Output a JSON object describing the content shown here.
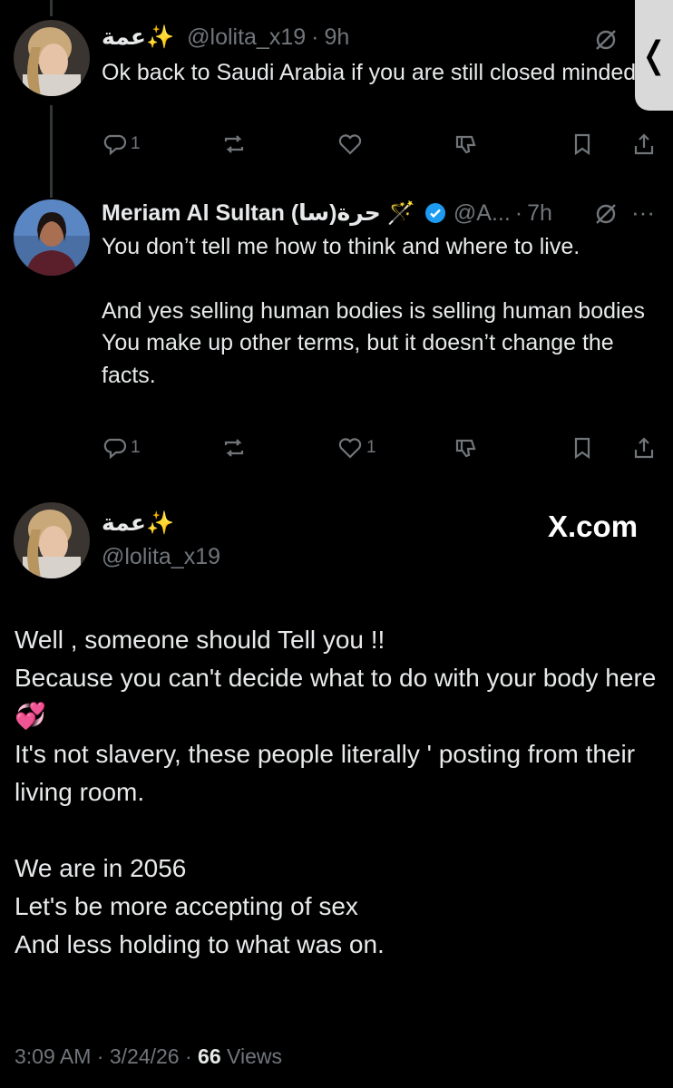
{
  "tweet1": {
    "display_name": "عمة✨",
    "handle": "@lolita_x19",
    "time": "9h",
    "text": "Ok back to Saudi Arabia if you are still closed minded",
    "replies": "1",
    "retweets": "",
    "likes": "",
    "icons": [
      "grok-icon",
      "reply-icon",
      "retweet-icon",
      "like-icon",
      "downvote-icon",
      "bookmark-icon",
      "share-icon"
    ]
  },
  "tweet2": {
    "display_name": "Meriam Al Sultan (سا)حرة 🪄",
    "handle": "@A...",
    "time": "7h",
    "text_p1": "You don’t tell me how to think and where to live.",
    "text_p2": "And yes selling human bodies is selling human bodies\nYou make up other terms, but it doesn’t change the facts.",
    "replies": "1",
    "retweets": "",
    "likes": "1",
    "verified_color": "#1d9bf0"
  },
  "main_tweet": {
    "display_name": "عمة✨",
    "handle": "@lolita_x19",
    "source": "X.com",
    "text": "Well , someone should Tell you !!\nBecause you can't decide what to do with your body here\n💞\nIt's not slavery, these people literally ' posting from their living room.\n\nWe are in 2056\nLet's be more accepting of sex\nAnd less holding to what was on.",
    "time": "3:09 AM",
    "date": "3/24/26",
    "views_count": "66",
    "views_label": "Views"
  },
  "side_tab": {
    "glyph": "❬"
  },
  "colors": {
    "background": "#000000",
    "text": "#e7e9ea",
    "muted": "#71767b",
    "accent": "#1d9bf0"
  }
}
